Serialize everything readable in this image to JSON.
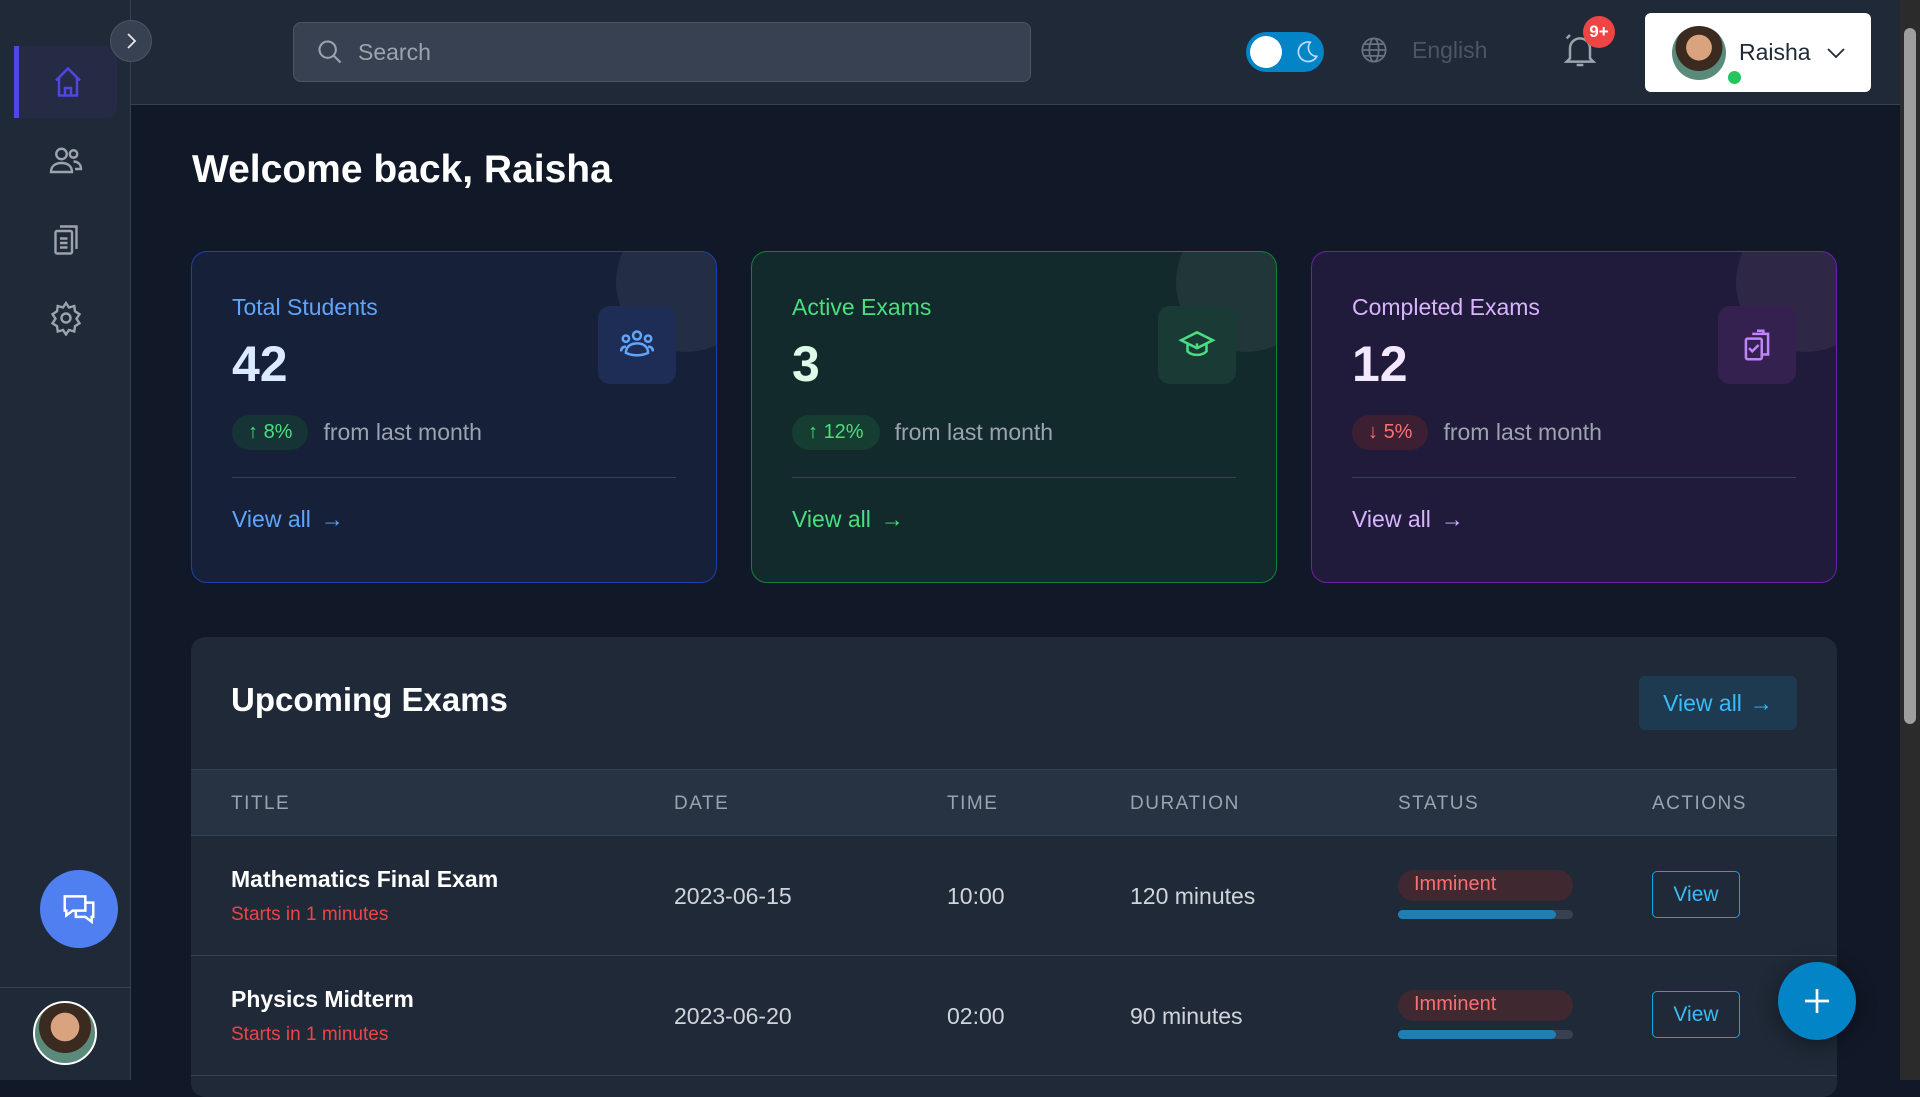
{
  "header": {
    "search_placeholder": "Search",
    "language": "English",
    "notification_count": "9+",
    "user_name": "Raisha",
    "theme": "dark"
  },
  "sidebar": {
    "items": [
      {
        "name": "home",
        "active": true
      },
      {
        "name": "users"
      },
      {
        "name": "exams"
      },
      {
        "name": "settings"
      }
    ]
  },
  "welcome": "Welcome back, Raisha",
  "cards": [
    {
      "title": "Total Students",
      "value": "42",
      "trend": "8%",
      "trend_dir": "up",
      "trend_text": "from last month",
      "link": "View all",
      "accent": "#60a5fa"
    },
    {
      "title": "Active Exams",
      "value": "3",
      "trend": "12%",
      "trend_dir": "up",
      "trend_text": "from last month",
      "link": "View all",
      "accent": "#4ade80"
    },
    {
      "title": "Completed Exams",
      "value": "12",
      "trend": "5%",
      "trend_dir": "down",
      "trend_text": "from last month",
      "link": "View all",
      "accent": "#d8b4fe"
    }
  ],
  "upcoming": {
    "title": "Upcoming Exams",
    "view_all": "View all",
    "columns": [
      "TITLE",
      "DATE",
      "TIME",
      "DURATION",
      "STATUS",
      "ACTIONS"
    ],
    "rows": [
      {
        "title": "Mathematics Final Exam",
        "subtitle": "Starts in 1 minutes",
        "date": "2023-06-15",
        "time": "10:00",
        "duration": "120 minutes",
        "status": "Imminent",
        "progress": 0.9,
        "action": "View"
      },
      {
        "title": "Physics Midterm",
        "subtitle": "Starts in 1 minutes",
        "date": "2023-06-20",
        "time": "02:00",
        "duration": "90 minutes",
        "status": "Imminent",
        "progress": 0.9,
        "action": "View"
      }
    ]
  }
}
